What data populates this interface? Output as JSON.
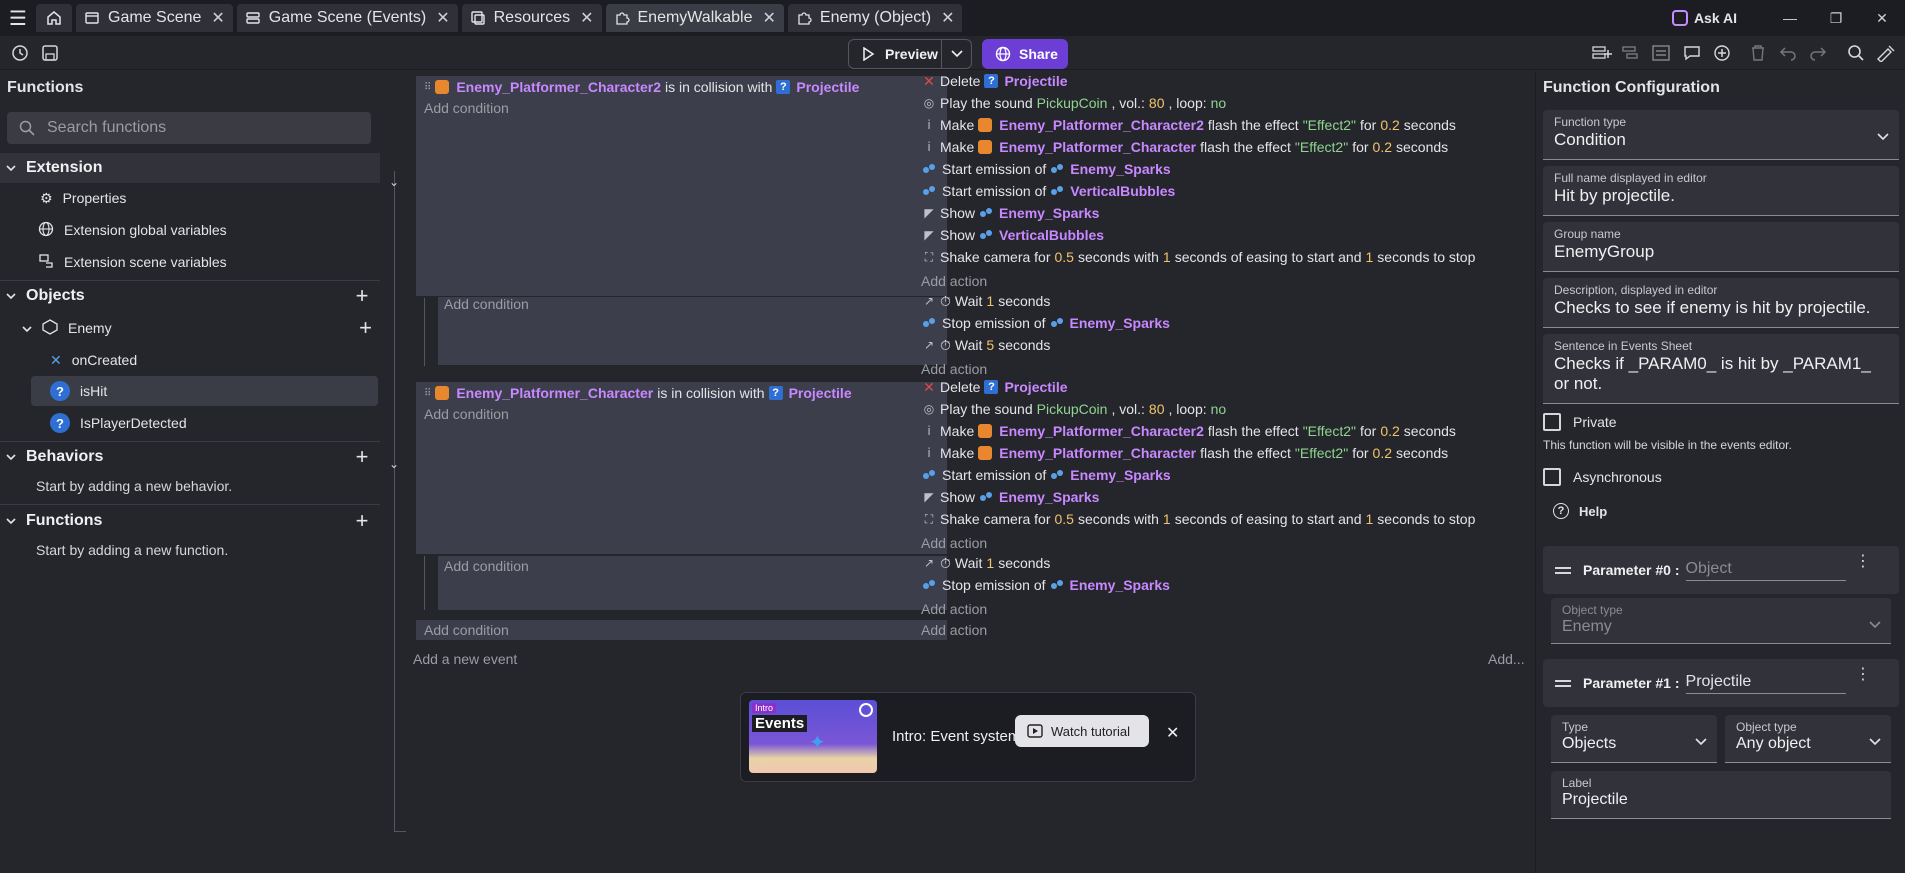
{
  "tabs": [
    {
      "label": "Game Scene",
      "icon": "scene-icon"
    },
    {
      "label": "Game Scene (Events)",
      "icon": "events-icon"
    },
    {
      "label": "Resources",
      "icon": "resources-icon"
    },
    {
      "label": "EnemyWalkable",
      "icon": "extension-icon",
      "active": true
    },
    {
      "label": "Enemy (Object)",
      "icon": "extension-icon"
    }
  ],
  "askai": "Ask AI",
  "toolbar": {
    "preview": "Preview",
    "share": "Share"
  },
  "left": {
    "title": "Functions",
    "search_placeholder": "Search functions",
    "extension": {
      "header": "Extension",
      "items": [
        "Properties",
        "Extension global variables",
        "Extension scene variables"
      ]
    },
    "objects": {
      "header": "Objects",
      "object_name": "Enemy",
      "functions": [
        "onCreated",
        "isHit",
        "IsPlayerDetected"
      ]
    },
    "behaviors": {
      "header": "Behaviors",
      "hint": "Start by adding a new behavior."
    },
    "functions": {
      "header": "Functions",
      "hint": "Start by adding a new function."
    }
  },
  "events": {
    "add_condition": "Add condition",
    "add_action": "Add action",
    "add_event": "Add a new event",
    "add_more": "Add...",
    "e1": {
      "cond_obj": "Enemy_Platformer_Character2",
      "cond_text": "is in collision with",
      "cond_target": "Projectile",
      "actions": {
        "delete": "Delete",
        "delete_obj": "Projectile",
        "sound_prefix": "Play the sound",
        "sound_name": "PickupCoin",
        "sound_vol_label": ", vol.:",
        "sound_vol": "80",
        "sound_loop_label": ", loop:",
        "sound_loop": "no",
        "make": "Make",
        "flash_text": "flash the effect",
        "effect": "\"Effect2\"",
        "for": "for",
        "duration": "0.2",
        "seconds": "seconds",
        "flash1_obj": "Enemy_Platformer_Character2",
        "flash2_obj": "Enemy_Platformer_Character",
        "start_emission": "Start emission of",
        "emit1": "Enemy_Sparks",
        "emit2": "VerticalBubbles",
        "show": "Show",
        "show1": "Enemy_Sparks",
        "show2": "VerticalBubbles",
        "shake_a": "Shake camera for",
        "shake_dur": "0.5",
        "shake_b": "seconds with",
        "shake_ease1": "1",
        "shake_c": "seconds of easing to start and",
        "shake_ease2": "1",
        "shake_d": "seconds to stop"
      },
      "sub": {
        "wait": "Wait",
        "wait1": "1",
        "seconds": "seconds",
        "stop_emission": "Stop emission of",
        "stop_obj": "Enemy_Sparks",
        "wait2": "5"
      }
    },
    "e2": {
      "cond_obj": "Enemy_Platformer_Character",
      "cond_text": "is in collision with",
      "cond_target": "Projectile",
      "actions": {
        "delete": "Delete",
        "delete_obj": "Projectile",
        "sound_prefix": "Play the sound",
        "sound_name": "PickupCoin",
        "sound_vol_label": ", vol.:",
        "sound_vol": "80",
        "sound_loop_label": ", loop:",
        "sound_loop": "no",
        "make": "Make",
        "flash_text": "flash the effect",
        "effect": "\"Effect2\"",
        "for": "for",
        "duration": "0.2",
        "seconds": "seconds",
        "flash1_obj": "Enemy_Platformer_Character2",
        "flash2_obj": "Enemy_Platformer_Character",
        "start_emission": "Start emission of",
        "emit1": "Enemy_Sparks",
        "show": "Show",
        "show1": "Enemy_Sparks",
        "shake_a": "Shake camera for",
        "shake_dur": "0.5",
        "shake_b": "seconds with",
        "shake_ease1": "1",
        "shake_c": "seconds of easing to start and",
        "shake_ease2": "1",
        "shake_d": "seconds to stop"
      },
      "sub": {
        "wait": "Wait",
        "wait1": "1",
        "seconds": "seconds",
        "stop_emission": "Stop emission of",
        "stop_obj": "Enemy_Sparks"
      }
    }
  },
  "tutorial": {
    "badge": "Intro",
    "thumb_title": "Events",
    "title": "Intro: Event system",
    "button": "Watch tutorial"
  },
  "right": {
    "title": "Function Configuration",
    "function_type": {
      "label": "Function type",
      "value": "Condition"
    },
    "full_name": {
      "label": "Full name displayed in editor",
      "value": "Hit by projectile."
    },
    "group_name": {
      "label": "Group name",
      "value": "EnemyGroup"
    },
    "description": {
      "label": "Description, displayed in editor",
      "value": "Checks to see if enemy is hit by projectile."
    },
    "sentence": {
      "label": "Sentence in Events Sheet",
      "value": "Checks if _PARAM0_ is hit by _PARAM1_ or not."
    },
    "private": {
      "label": "Private",
      "note": "This function will be visible in the events editor."
    },
    "async": {
      "label": "Asynchronous"
    },
    "help": "Help",
    "param0": {
      "label": "Parameter #0 :",
      "placeholder": "Object",
      "object_type_label": "Object type",
      "object_type_value": "Enemy"
    },
    "param1": {
      "label": "Parameter #1 :",
      "value": "Projectile",
      "type_label": "Type",
      "type_value": "Objects",
      "object_type_label": "Object type",
      "object_type_value": "Any object",
      "label_label": "Label",
      "label_value": "Projectile"
    }
  }
}
